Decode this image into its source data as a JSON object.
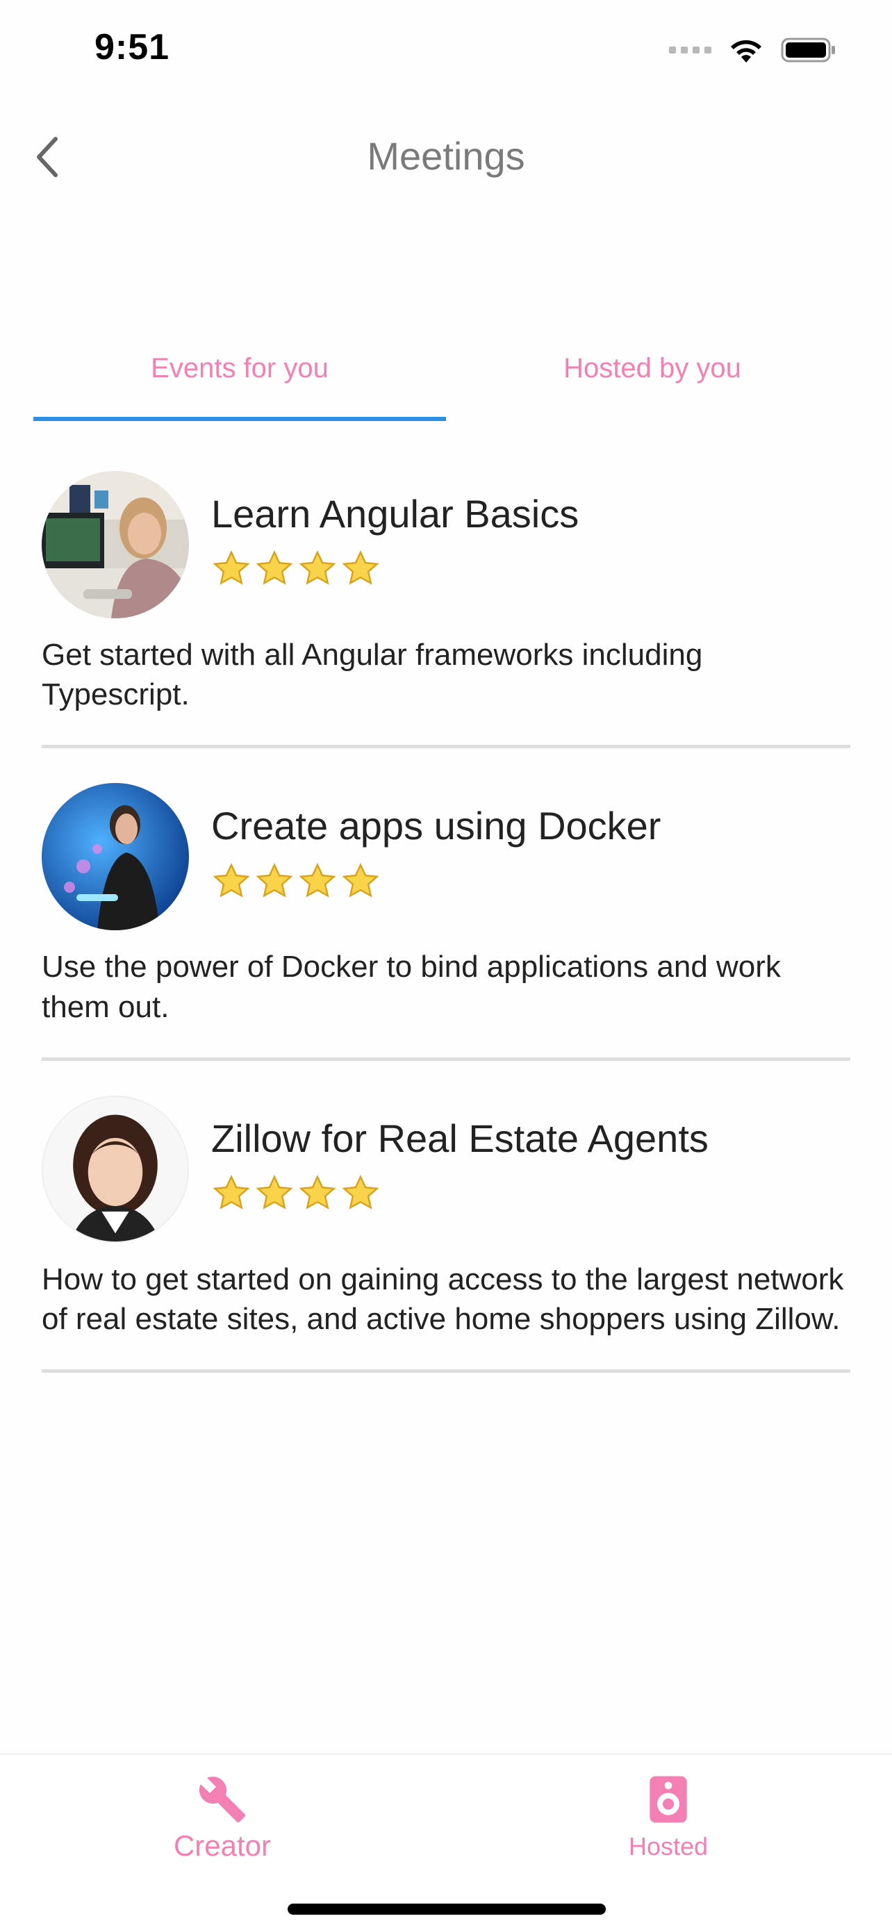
{
  "status_bar": {
    "time": "9:51"
  },
  "nav": {
    "title": "Meetings",
    "back_icon": "chevron-left-icon"
  },
  "tabs": [
    {
      "label": "Events for you",
      "active": true
    },
    {
      "label": "Hosted by you",
      "active": false
    }
  ],
  "events": [
    {
      "title": "Learn Angular Basics",
      "rating": 4,
      "description": "Get started with all Angular frameworks including Typescript."
    },
    {
      "title": "Create apps using Docker",
      "rating": 4,
      "description": "Use the power of Docker to bind applications and work them out."
    },
    {
      "title": "Zillow for Real Estate Agents",
      "rating": 4,
      "description": "How to get started on gaining access to the largest network of real estate sites, and active home shoppers using Zillow."
    }
  ],
  "bottom_nav": {
    "items": [
      {
        "label": "Creator",
        "icon": "wrench-icon"
      },
      {
        "label": "Hosted",
        "icon": "speaker-icon"
      }
    ]
  },
  "colors": {
    "accent_pink": "#f47fb2",
    "tab_indicator": "#2b8fe6",
    "star": "#f5c518",
    "divider": "#dedede"
  }
}
